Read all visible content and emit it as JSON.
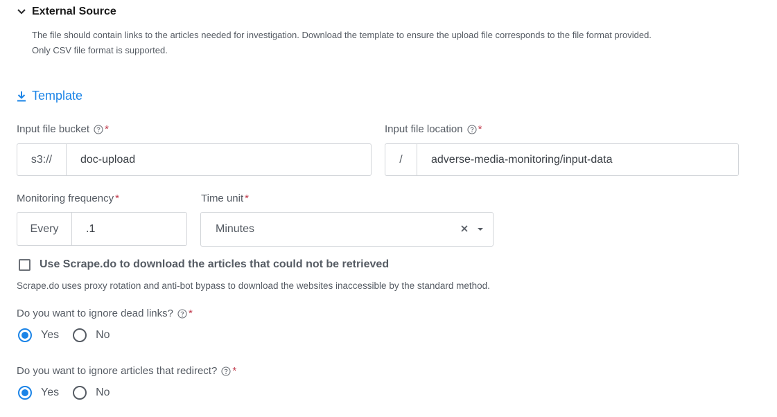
{
  "section": {
    "title": "External Source",
    "description_line1": "The file should contain links to the articles needed for investigation. Download the template to ensure the upload file corresponds to the file format provided.",
    "description_line2": "Only CSV file format is supported."
  },
  "template_link": {
    "label": "Template",
    "icon": "download-icon"
  },
  "bucket": {
    "label": "Input file bucket",
    "required_mark": "*",
    "prefix": "s3://",
    "value": "doc-upload"
  },
  "location": {
    "label": "Input file location",
    "required_mark": "*",
    "prefix": "/",
    "value": "adverse-media-monitoring/input-data"
  },
  "frequency": {
    "label": "Monitoring frequency",
    "required_mark": "*",
    "prefix": "Every",
    "value": ".1"
  },
  "time_unit": {
    "label": "Time unit",
    "required_mark": "*",
    "selected": "Minutes"
  },
  "scrape": {
    "label": "Use Scrape.do to download the articles that could not be retrieved",
    "checked": false,
    "note": "Scrape.do uses proxy rotation and anti-bot bypass to download the websites inaccessible by the standard method."
  },
  "dead_links": {
    "question": "Do you want to ignore dead links?",
    "required_mark": "*",
    "options": [
      "Yes",
      "No"
    ],
    "selected": "Yes"
  },
  "redirects": {
    "question": "Do you want to ignore articles that redirect?",
    "required_mark": "*",
    "options": [
      "Yes",
      "No"
    ],
    "selected": "Yes"
  },
  "colors": {
    "accent": "#1b84e7",
    "required": "#c0394b",
    "border": "#d2d5d9",
    "text": "#555b63"
  }
}
